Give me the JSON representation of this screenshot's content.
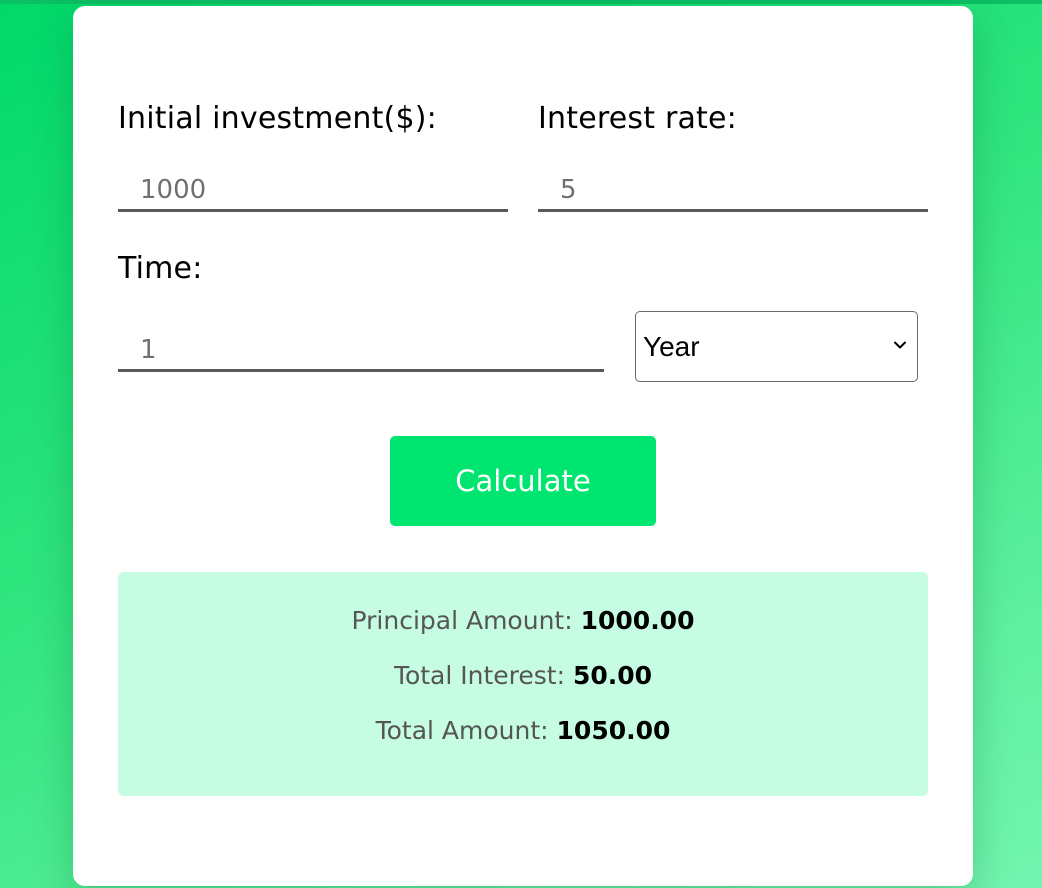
{
  "form": {
    "initial_investment": {
      "label": "Initial investment($):",
      "value": "1000"
    },
    "interest_rate": {
      "label": "Interest rate:",
      "value": "5"
    },
    "time": {
      "label": "Time:",
      "value": "1",
      "unit_selected": "Year"
    },
    "calculate_label": "Calculate"
  },
  "results": {
    "principal_label": "Principal Amount:",
    "principal_value": "1000.00",
    "interest_label": "Total Interest:",
    "interest_value": "50.00",
    "total_label": "Total Amount:",
    "total_value": "1050.00"
  },
  "colors": {
    "accent": "#00e570",
    "results_bg": "#c6fde2",
    "page_gradient_start": "#00d96a",
    "page_gradient_end": "#72f5b0"
  },
  "icons": {
    "select_arrow": "chevron-down-icon"
  }
}
